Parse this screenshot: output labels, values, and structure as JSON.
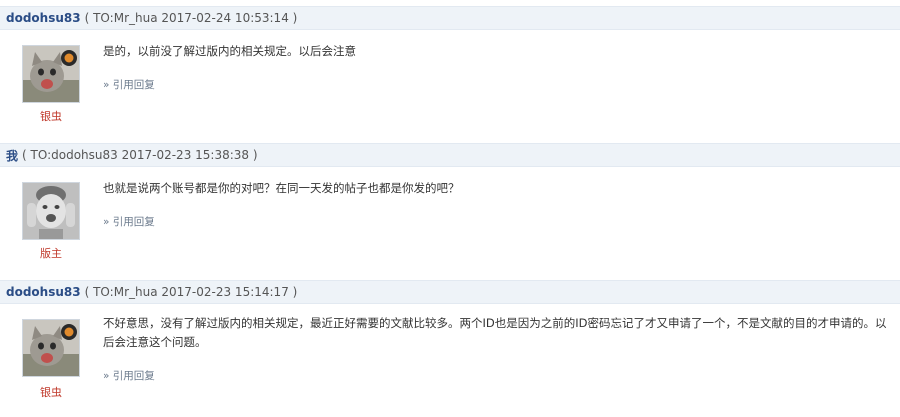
{
  "posts": [
    {
      "author": "dodohsu83",
      "meta": "( TO:Mr_hua   2017-02-24 10:53:14 )",
      "content": "是的，以前没了解过版内的相关规定。以后会注意",
      "reply_label": "» 引用回复",
      "role": "银虫",
      "avatar": "cat-avatar"
    },
    {
      "author": "我",
      "meta": "( TO:dodohsu83   2017-02-23 15:38:38 )",
      "content": "也就是说两个账号都是你的对吧？在同一天发的帖子也都是你发的吧？",
      "reply_label": "» 引用回复",
      "role": "版主",
      "avatar": "child-avatar"
    },
    {
      "author": "dodohsu83",
      "meta": "( TO:Mr_hua   2017-02-23 15:14:17 )",
      "content": "不好意思，没有了解过版内的相关规定，最近正好需要的文献比较多。两个ID也是因为之前的ID密码忘记了才又申请了一个，不是文献的目的才申请的。以后会注意这个问题。",
      "reply_label": "» 引用回复",
      "role": "银虫",
      "avatar": "cat-avatar"
    }
  ],
  "colors": {
    "header_bg": "#eef3f8",
    "author": "#2b4d86",
    "role": "#c0392b"
  }
}
